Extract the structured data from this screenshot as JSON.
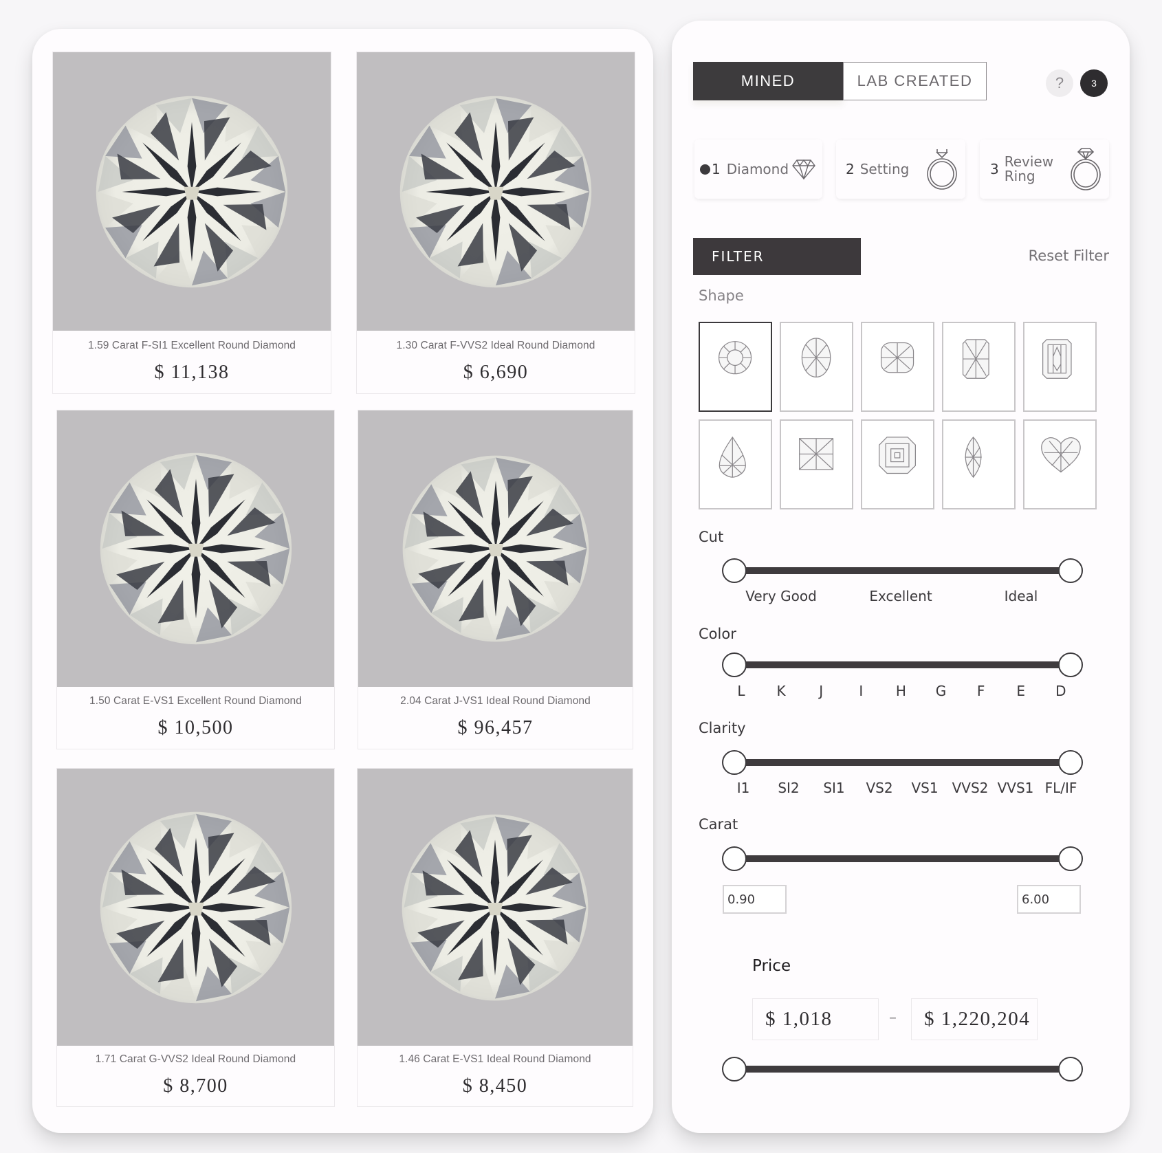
{
  "products": [
    {
      "title": "1.59 Carat F-SI1 Excellent Round Diamond",
      "price": "$ 11,138",
      "shape": "round"
    },
    {
      "title": "1.30 Carat F-VVS2 Ideal Round Diamond",
      "price": "$ 6,690",
      "shape": "round"
    },
    {
      "title": "1.50 Carat E-VS1 Excellent Round Diamond",
      "price": "$ 10,500",
      "shape": "round"
    },
    {
      "title": "2.04 Carat J-VS1 Ideal Round Diamond",
      "price": "$ 96,457",
      "shape": "round"
    },
    {
      "title": "1.71 Carat G-VVS2 Ideal Round Diamond",
      "price": "$ 8,700",
      "shape": "round"
    },
    {
      "title": "1.46 Carat E-VS1 Ideal Round Diamond",
      "price": "$ 8,450",
      "shape": "round"
    }
  ],
  "origin_toggle": {
    "mined_label": "MINED",
    "lab_label": "LAB CREATED",
    "selected": "MINED"
  },
  "header_icons": {
    "help_label": "?",
    "count_badge": "3"
  },
  "steps": [
    {
      "number": "1",
      "label": "Diamond",
      "active": true,
      "icon": "diamond-icon"
    },
    {
      "number": "2",
      "label": "Setting",
      "active": false,
      "icon": "ring-setting-icon"
    },
    {
      "number": "3",
      "label_line1": "Review",
      "label_line2": "Ring",
      "active": false,
      "icon": "ring-with-diamond-icon"
    }
  ],
  "filter": {
    "header": "FILTER",
    "reset_label": "Reset Filter",
    "shape": {
      "label": "Shape",
      "options": [
        "Round",
        "Oval",
        "Cushion",
        "Radiant",
        "Emerald",
        "Pear",
        "Princess",
        "Asscher",
        "Marquise",
        "Heart"
      ],
      "selected": "Round"
    },
    "cut": {
      "label": "Cut",
      "ticks": [
        "Very Good",
        "Excellent",
        "Ideal"
      ],
      "range": {
        "min_fraction": 0,
        "max_fraction": 1
      }
    },
    "color": {
      "label": "Color",
      "ticks": [
        "L",
        "K",
        "J",
        "I",
        "H",
        "G",
        "F",
        "E",
        "D"
      ],
      "range": {
        "min_fraction": 0,
        "max_fraction": 1
      }
    },
    "clarity": {
      "label": "Clarity",
      "ticks": [
        "I1",
        "SI2",
        "SI1",
        "VS2",
        "VS1",
        "VVS2",
        "VVS1",
        "FL/IF"
      ],
      "range": {
        "min_fraction": 0,
        "max_fraction": 1
      }
    },
    "carat": {
      "label": "Carat",
      "min_value": "0.90",
      "max_value": "6.00",
      "range": {
        "min_fraction": 0,
        "max_fraction": 1
      }
    },
    "price": {
      "label": "Price",
      "min_value": "$ 1,018",
      "max_value": "$ 1,220,204",
      "separator": "–",
      "range": {
        "min_fraction": 0,
        "max_fraction": 1
      }
    }
  }
}
